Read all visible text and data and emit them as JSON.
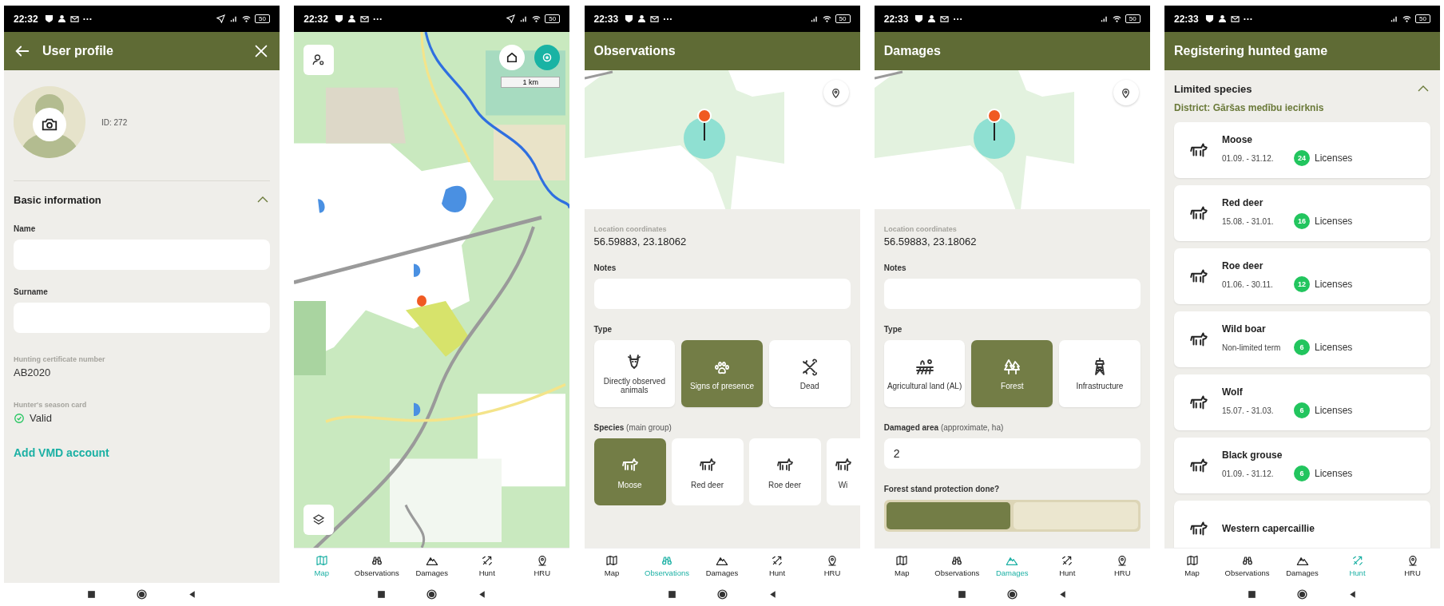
{
  "screens": [
    {
      "kind": "profile",
      "status_bar": {
        "time": "22:32",
        "more": "···",
        "location": true,
        "battery": "50"
      },
      "header": {
        "title": "User profile",
        "back": true,
        "close": true
      },
      "profile": {
        "id": "ID: 272"
      },
      "section": {
        "title": "Basic information",
        "expanded": true
      },
      "inputs": [
        {
          "label": "Name"
        },
        {
          "label": "Surname"
        }
      ],
      "details": [
        {
          "kind": "text",
          "label": "Hunting certificate number",
          "value": "AB2020"
        },
        {
          "kind": "status",
          "label": "Hunter's season card",
          "value": "Valid"
        }
      ],
      "link": "Add VMD account"
    },
    {
      "kind": "map",
      "status_bar": {
        "time": "22:32",
        "more": "···",
        "location": true,
        "battery": "50"
      },
      "scale": "1 km",
      "nav": [
        {
          "label": "Map",
          "selected": true
        },
        {
          "label": "Observations",
          "selected": false
        },
        {
          "label": "Damages",
          "selected": false
        },
        {
          "label": "Hunt",
          "selected": false
        },
        {
          "label": "HRU",
          "selected": false
        }
      ]
    },
    {
      "kind": "form",
      "status_bar": {
        "time": "22:33",
        "more": "···",
        "location": false,
        "battery": "50"
      },
      "header": {
        "title": "Observations"
      },
      "coordinates": {
        "label": "Location coordinates",
        "value": "56.59883, 23.18062"
      },
      "notes_label": "Notes",
      "type_label": "Type",
      "types": [
        {
          "label": "Directly observed animals",
          "selected": false
        },
        {
          "label": "Signs of presence",
          "selected": true
        },
        {
          "label": "Dead",
          "selected": false
        }
      ],
      "species_label": "**Species** (main group)",
      "species": [
        {
          "label": "Moose",
          "selected": true
        },
        {
          "label": "Red deer",
          "selected": false
        },
        {
          "label": "Roe deer",
          "selected": false
        },
        {
          "label": "Wi",
          "selected": false
        }
      ],
      "nav": [
        {
          "label": "Map",
          "selected": false
        },
        {
          "label": "Observations",
          "selected": true
        },
        {
          "label": "Damages",
          "selected": false
        },
        {
          "label": "Hunt",
          "selected": false
        },
        {
          "label": "HRU",
          "selected": false
        }
      ]
    },
    {
      "kind": "form",
      "status_bar": {
        "time": "22:33",
        "more": "···",
        "location": false,
        "battery": "50"
      },
      "header": {
        "title": "Damages"
      },
      "coordinates": {
        "label": "Location coordinates",
        "value": "56.59883, 23.18062"
      },
      "notes_label": "Notes",
      "type_label": "Type",
      "types": [
        {
          "label": "Agricultural land (AL)",
          "selected": false
        },
        {
          "label": "Forest",
          "selected": true
        },
        {
          "label": "Infrastructure",
          "selected": false
        }
      ],
      "area_label": "**Damaged area** (approximate, ha)",
      "area_value": "2",
      "protection_label": "Forest stand protection done?",
      "protection_options": [
        {
          "selected": true
        },
        {
          "selected": false
        }
      ],
      "nav": [
        {
          "label": "Map",
          "selected": false
        },
        {
          "label": "Observations",
          "selected": false
        },
        {
          "label": "Damages",
          "selected": true
        },
        {
          "label": "Hunt",
          "selected": false
        },
        {
          "label": "HRU",
          "selected": false
        }
      ]
    },
    {
      "kind": "hunt",
      "status_bar": {
        "time": "22:33",
        "more": "···",
        "location": false,
        "battery": "50"
      },
      "header": {
        "title": "Registering hunted game"
      },
      "section": {
        "title": "Limited species",
        "expanded": true
      },
      "district": "District: Gāršas medību iecirknis",
      "game": [
        {
          "name": "Moose",
          "term": "01.09. - 31.12.",
          "count": "24",
          "unit": "Licenses"
        },
        {
          "name": "Red deer",
          "term": "15.08. - 31.01.",
          "count": "16",
          "unit": "Licenses"
        },
        {
          "name": "Roe deer",
          "term": "01.06. - 30.11.",
          "count": "12",
          "unit": "Licenses"
        },
        {
          "name": "Wild boar",
          "term": "Non-limited term",
          "count": "6",
          "unit": "Licenses"
        },
        {
          "name": "Wolf",
          "term": "15.07. - 31.03.",
          "count": "6",
          "unit": "Licenses"
        },
        {
          "name": "Black grouse",
          "term": "01.09. - 31.12.",
          "count": "6",
          "unit": "Licenses"
        },
        {
          "name": "Western capercaillie"
        }
      ],
      "nav": [
        {
          "label": "Map",
          "selected": false
        },
        {
          "label": "Observations",
          "selected": false
        },
        {
          "label": "Damages",
          "selected": false
        },
        {
          "label": "Hunt",
          "selected": true
        },
        {
          "label": "HRU",
          "selected": false
        }
      ]
    }
  ]
}
